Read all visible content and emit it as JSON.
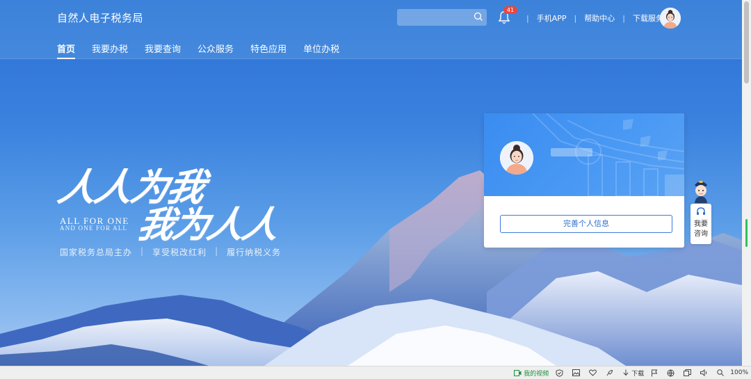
{
  "header": {
    "brand": "自然人电子税务局",
    "search": {
      "placeholder": ""
    },
    "notification_count": "41",
    "links": [
      "手机APP",
      "帮助中心",
      "下载服务"
    ]
  },
  "nav": {
    "tabs": [
      {
        "label": "首页",
        "active": true
      },
      {
        "label": "我要办税",
        "active": false
      },
      {
        "label": "我要查询",
        "active": false
      },
      {
        "label": "公众服务",
        "active": false
      },
      {
        "label": "特色应用",
        "active": false
      },
      {
        "label": "单位办税",
        "active": false
      }
    ]
  },
  "hero": {
    "slogan_line1": "人人为我",
    "slogan_line2": "我为人人",
    "english_line1": "ALL FOR ONE",
    "english_line2": "AND ONE FOR ALL",
    "subline": [
      "国家税务总局主办",
      "享受税改红利",
      "履行纳税义务"
    ]
  },
  "user_card": {
    "name": "",
    "complete_button": "完善个人信息"
  },
  "consult": {
    "label_line1": "我要",
    "label_line2": "咨询"
  },
  "statusbar": {
    "video": "我的视频",
    "download": "下载",
    "zoom": "100%"
  },
  "colors": {
    "primary": "#3c82da",
    "badge": "#e9473d",
    "button_border": "#3a7bd5"
  }
}
